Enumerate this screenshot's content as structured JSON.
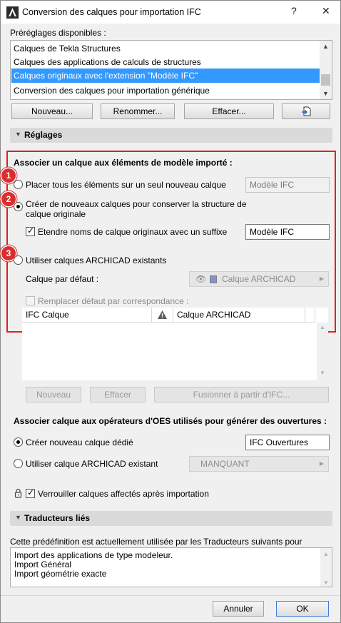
{
  "window": {
    "title": "Conversion des calques pour importation IFC",
    "help_glyph": "?",
    "close_glyph": "✕"
  },
  "presets": {
    "label": "Préréglages disponibles :",
    "items": [
      "Calques de Tekla Structures",
      "Calques des applications de calculs de structures",
      "Calques originaux avec l'extension \"Modèle IFC\"",
      "Conversion des calques pour importation générique"
    ],
    "selected_index": 2,
    "buttons": {
      "new": "Nouveau...",
      "rename": "Renommer...",
      "delete": "Effacer..."
    }
  },
  "settings": {
    "header": "Réglages",
    "assoc_title": "Associer un calque aux éléments de modèle importé :",
    "markers": [
      "1",
      "2",
      "3"
    ],
    "option1": {
      "label": "Placer tous les éléments sur un seul nouveau calque",
      "value": "Modèle IFC"
    },
    "option2": {
      "label_line1": "Créer de nouveaux calques pour conserver la structure de",
      "label_line2": "calque originale",
      "suffix_label": "Etendre noms de calque originaux avec un suffixe",
      "suffix_value": "Modèle IFC"
    },
    "option3": {
      "label": "Utiliser calques ARCHICAD existants",
      "default_label": "Calque par défaut :",
      "default_value": "Calque ARCHICAD",
      "replace_label": "Remplacer défaut par correspondance :"
    },
    "table": {
      "col1": "IFC Calque",
      "col3": "Calque ARCHICAD"
    },
    "table_buttons": {
      "new": "Nouveau",
      "delete": "Effacer",
      "merge": "Fusionner à partir d'IFC..."
    },
    "openings_title": "Associer calque aux opérateurs d'OES utilisés pour générer des ouvertures :",
    "openings_opt1": {
      "label": "Créer nouveau calque dédié",
      "value": "IFC Ouvertures"
    },
    "openings_opt2": {
      "label": "Utiliser calque ARCHICAD existant",
      "value": "MANQUANT"
    },
    "lock_label": "Verrouiller calques affectés après importation"
  },
  "translators": {
    "header": "Traducteurs liés",
    "description": "Cette prédéfinition est actuellement utilisée par les Traducteurs suivants pour",
    "items": [
      "Import des applications de type modeleur.",
      "Import Général",
      "Import géométrie exacte"
    ]
  },
  "footer": {
    "cancel": "Annuler",
    "ok": "OK"
  },
  "colors": {
    "selection": "#3399ff",
    "highlight_border": "#e02020",
    "marker": "#d92f2f"
  }
}
